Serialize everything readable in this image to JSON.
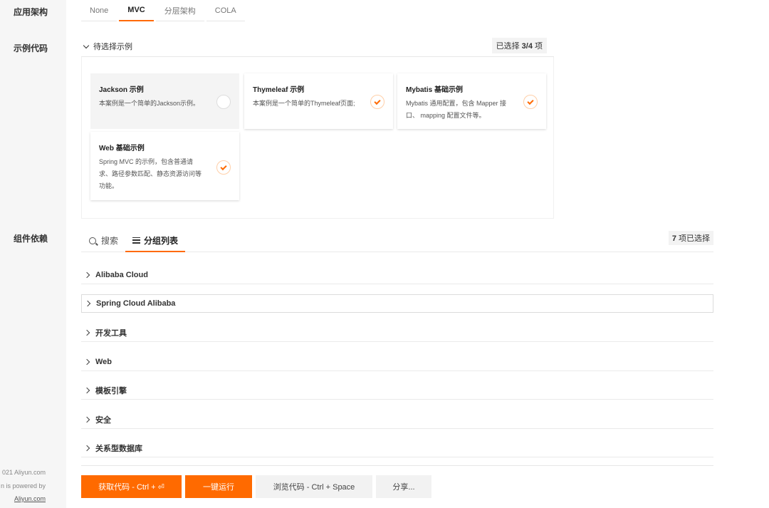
{
  "sidebar": {
    "architecture_label": "应用架构",
    "sample_code_label": "示例代码",
    "dependencies_label": "组件依赖",
    "footer": {
      "copyright": "021 Aliyun.com",
      "powered_by": "n is powered by",
      "link": "Aliyun.com"
    }
  },
  "architecture": {
    "tabs": [
      {
        "label": "None"
      },
      {
        "label": "MVC"
      },
      {
        "label": "分层架构"
      },
      {
        "label": "COLA"
      }
    ],
    "selected": "MVC"
  },
  "examples": {
    "toggle_label": "待选择示例",
    "selected_prefix": "已选择 ",
    "selected_value": "3/4",
    "selected_suffix": " 项",
    "cards": [
      {
        "title": "Jackson 示例",
        "description": "本案例是一个简单的Jackson示例。",
        "checked": false
      },
      {
        "title": "Thymeleaf 示例",
        "description": "本案例是一个简单的Thymeleaf页面;",
        "checked": true
      },
      {
        "title": "Mybatis 基础示例",
        "description": "Mybatis 通用配置，包含 Mapper 接口、 mapping 配置文件等。",
        "checked": true
      },
      {
        "title": "Web 基础示例",
        "description": "Spring MVC 的示例，包含普通请求、路径参数匹配、静态资源访问等功能。",
        "checked": true
      }
    ]
  },
  "dependencies": {
    "tabs": [
      {
        "label": "搜索",
        "icon": "search-icon"
      },
      {
        "label": "分组列表",
        "icon": "list-icon"
      }
    ],
    "active_tab": "分组列表",
    "selected_value": "7",
    "selected_suffix": " 项已选择",
    "groups": [
      {
        "label": "Alibaba Cloud"
      },
      {
        "label": "Spring Cloud Alibaba"
      },
      {
        "label": "开发工具"
      },
      {
        "label": "Web"
      },
      {
        "label": "模板引擎"
      },
      {
        "label": "安全"
      },
      {
        "label": "关系型数据库"
      }
    ]
  },
  "actions": {
    "get_code": "获取代码 - Ctrl + ⏎",
    "run": "一键运行",
    "browse": "浏览代码 - Ctrl + Space",
    "share": "分享..."
  },
  "colors": {
    "accent": "#ff6a00",
    "sidebar_bg": "#f6f6f6"
  }
}
